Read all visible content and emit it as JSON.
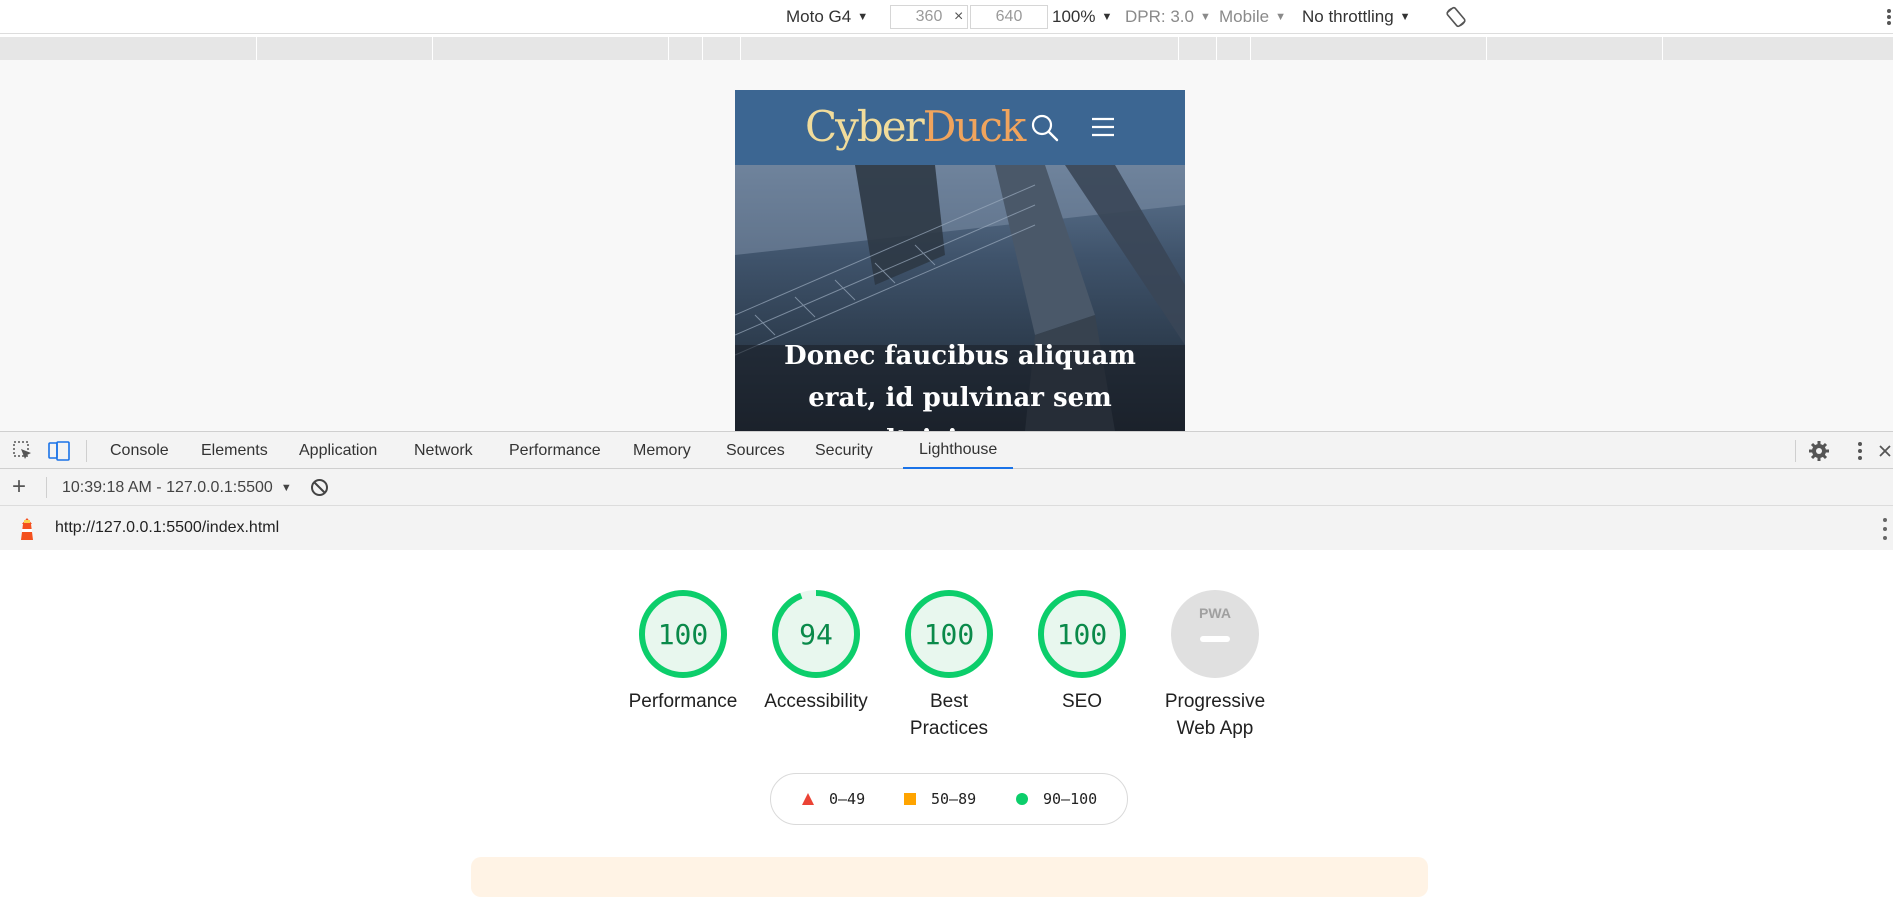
{
  "device_toolbar": {
    "device": "Moto G4",
    "width": "360",
    "height": "640",
    "times": "×",
    "zoom": "100%",
    "dpr": "DPR: 3.0",
    "mode": "Mobile",
    "throttling": "No throttling"
  },
  "site": {
    "logo_part1": "Cyber",
    "logo_part2": "Duck",
    "hero_text": "Donec faucibus aliquam erat, id pulvinar sem ultricies non"
  },
  "devtools": {
    "tabs": [
      "Console",
      "Elements",
      "Application",
      "Network",
      "Performance",
      "Memory",
      "Sources",
      "Security",
      "Lighthouse"
    ],
    "active_tab": "Lighthouse"
  },
  "lighthouse": {
    "report_selector": "10:39:18 AM - 127.0.0.1:5500",
    "url": "http://127.0.0.1:5500/index.html",
    "scores": [
      {
        "label": "Performance",
        "score": "100",
        "value": 100
      },
      {
        "label": "Accessibility",
        "score": "94",
        "value": 94
      },
      {
        "label": "Best Practices",
        "score": "100",
        "value": 100
      },
      {
        "label": "SEO",
        "score": "100",
        "value": 100
      }
    ],
    "pwa": {
      "label": "Progressive Web App",
      "badge": "PWA"
    },
    "legend": [
      {
        "range": "0–49",
        "color": "#eb4335",
        "shape": "triangle"
      },
      {
        "range": "50–89",
        "color": "#ffa400",
        "shape": "square"
      },
      {
        "range": "90–100",
        "color": "#0cce6b",
        "shape": "circle"
      }
    ]
  },
  "colors": {
    "pass_green": "#0cce6b",
    "pass_fill": "#e8f7ee",
    "tab_active": "#1a73e8",
    "site_header": "#3c6692"
  }
}
